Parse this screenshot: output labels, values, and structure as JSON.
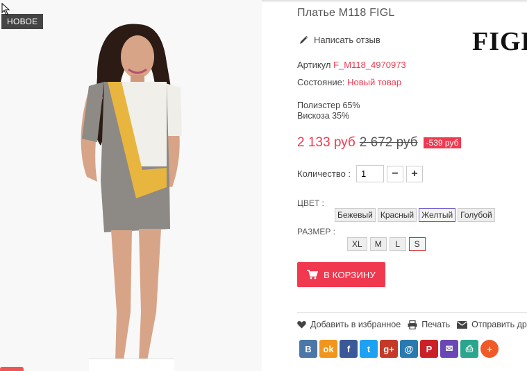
{
  "badge": "НОВОЕ",
  "product": {
    "title": "Платье M118 FIGL",
    "brand": "FIGL",
    "review_label": "Написать отзыв",
    "article_label": "Артикул",
    "article_value": "F_M118_4970973",
    "condition_label": "Состояние:",
    "condition_value": "Новый товар",
    "composition_1": "Полиэстер 65%",
    "composition_2": "Вискоза 35%"
  },
  "price": {
    "current": "2 133 руб",
    "old": "2 672 руб",
    "discount": "-539 руб"
  },
  "quantity": {
    "label": "Количество :",
    "value": "1",
    "minus": "−",
    "plus": "+"
  },
  "color": {
    "label": "ЦВЕТ :",
    "options": [
      "Бежевый",
      "Красный",
      "Желтый",
      "Голубой"
    ],
    "selected": "Желтый"
  },
  "size": {
    "label": "РАЗМЕР :",
    "options": [
      "XL",
      "M",
      "L",
      "S"
    ],
    "selected": "S"
  },
  "cart_label": "В КОРЗИНУ",
  "actions": {
    "wishlist": "Добавить в избранное",
    "print": "Печать",
    "send": "Отправить др"
  },
  "share": [
    {
      "icon": "vk-icon",
      "label": "В",
      "color": "#4a76a8"
    },
    {
      "icon": "odnoklassniki-icon",
      "label": "ok",
      "color": "#f2951c"
    },
    {
      "icon": "facebook-icon",
      "label": "f",
      "color": "#3b5998"
    },
    {
      "icon": "twitter-icon",
      "label": "t",
      "color": "#1da1f2"
    },
    {
      "icon": "google-plus-icon",
      "label": "g+",
      "color": "#c53929"
    },
    {
      "icon": "mail-ru-icon",
      "label": "@",
      "color": "#2a7ab0"
    },
    {
      "icon": "pinterest-icon",
      "label": "P",
      "color": "#cb2027"
    },
    {
      "icon": "email-icon",
      "label": "✉",
      "color": "#6a47b5"
    },
    {
      "icon": "print-icon",
      "label": "⎙",
      "color": "#2aa68e"
    },
    {
      "icon": "more-icon",
      "label": "+",
      "color": "#f05a28"
    }
  ],
  "colors": {
    "accent": "#f0394f",
    "badge_bg": "#444444"
  }
}
